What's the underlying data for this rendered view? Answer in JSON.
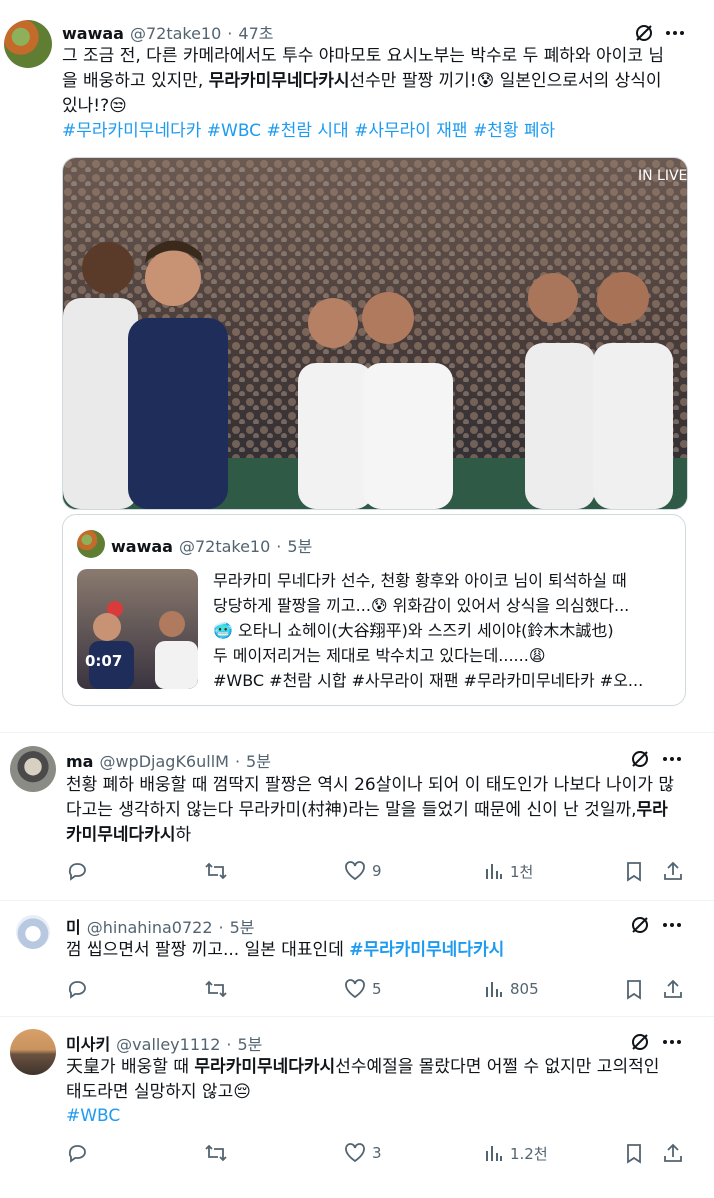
{
  "post": {
    "name": "wawaa",
    "handle": "@72take10",
    "dot": "·",
    "time": "47초",
    "lines": [
      "그 조금 전, 다른 카메라에서도 투수 야마모토 요시노부는 박수로 두 폐하와 아이코 님",
      "을 배웅하고 있지만, ",
      "무라카미무네다카시",
      "선수만 팔짱 끼기!😰 일본인으로서의 상식이",
      "있나!?😒"
    ],
    "hashtags": "#무라카미무네다카 #WBC #천람 시대 #사무라이 재팬 #천황 폐하",
    "video_badge": "IN LIVE"
  },
  "quote": {
    "name": "wawaa",
    "handle": "@72take10",
    "dot": "·",
    "time": "5분",
    "duration": "0:07",
    "lines": [
      "무라카미 무네다카 선수, 천황 황후와 아이코 님이 퇴석하실 때",
      "당당하게 팔짱을 끼고...😰 위화감이 있어서 상식을 의심했다...",
      "🥶 오타니 쇼헤이(大谷翔平)와 스즈키 세이야(鈴木木誠也)",
      "두 메이저리거는 제대로 박수치고 있다는데......😩",
      "#WBC #천람 시합 #사무라이 재팬 #무라카미무네타카 #오..."
    ]
  },
  "replies": [
    {
      "name": "ma",
      "handle": "@wpDjagK6ullM",
      "dot": "·",
      "time": "5분",
      "lines": [
        "천황 폐하 배웅할 때 껌딱지 팔짱은 역시 26살이나 되어 이 태도인가 나보다 나이가 많",
        "다고는 생각하지 않는다 무라카미(村神)라는 말을 들었기 때문에 신이 난 것일까,",
        "무라",
        "카미무네다카시",
        "하"
      ],
      "likes": "9",
      "views": "1천"
    },
    {
      "name": "미",
      "handle": "@hinahina0722",
      "dot": "·",
      "time": "5분",
      "lines": [
        "껌 씹으면서 팔짱 끼고... 일본 대표인데 ",
        "#무라카미무네다카시"
      ],
      "likes": "5",
      "views": "805"
    },
    {
      "name": "미사키",
      "handle": "@valley1112",
      "dot": "·",
      "time": "5분",
      "lines": [
        "天皇가 배웅할 때 ",
        "무라카미무네다카시",
        "선수예절을 몰랐다면 어쩔 수 없지만 고의적인",
        "태도라면 실망하지 않고😔",
        "#WBC"
      ],
      "likes": "3",
      "views": "1.2천"
    }
  ],
  "colors": {
    "link": "#1d9bf0",
    "muted": "#536471",
    "border": "#cfd9de"
  },
  "icons": [
    "grok-icon",
    "more-icon",
    "reply-icon",
    "retweet-icon",
    "like-icon",
    "views-icon",
    "bookmark-icon",
    "share-icon"
  ]
}
